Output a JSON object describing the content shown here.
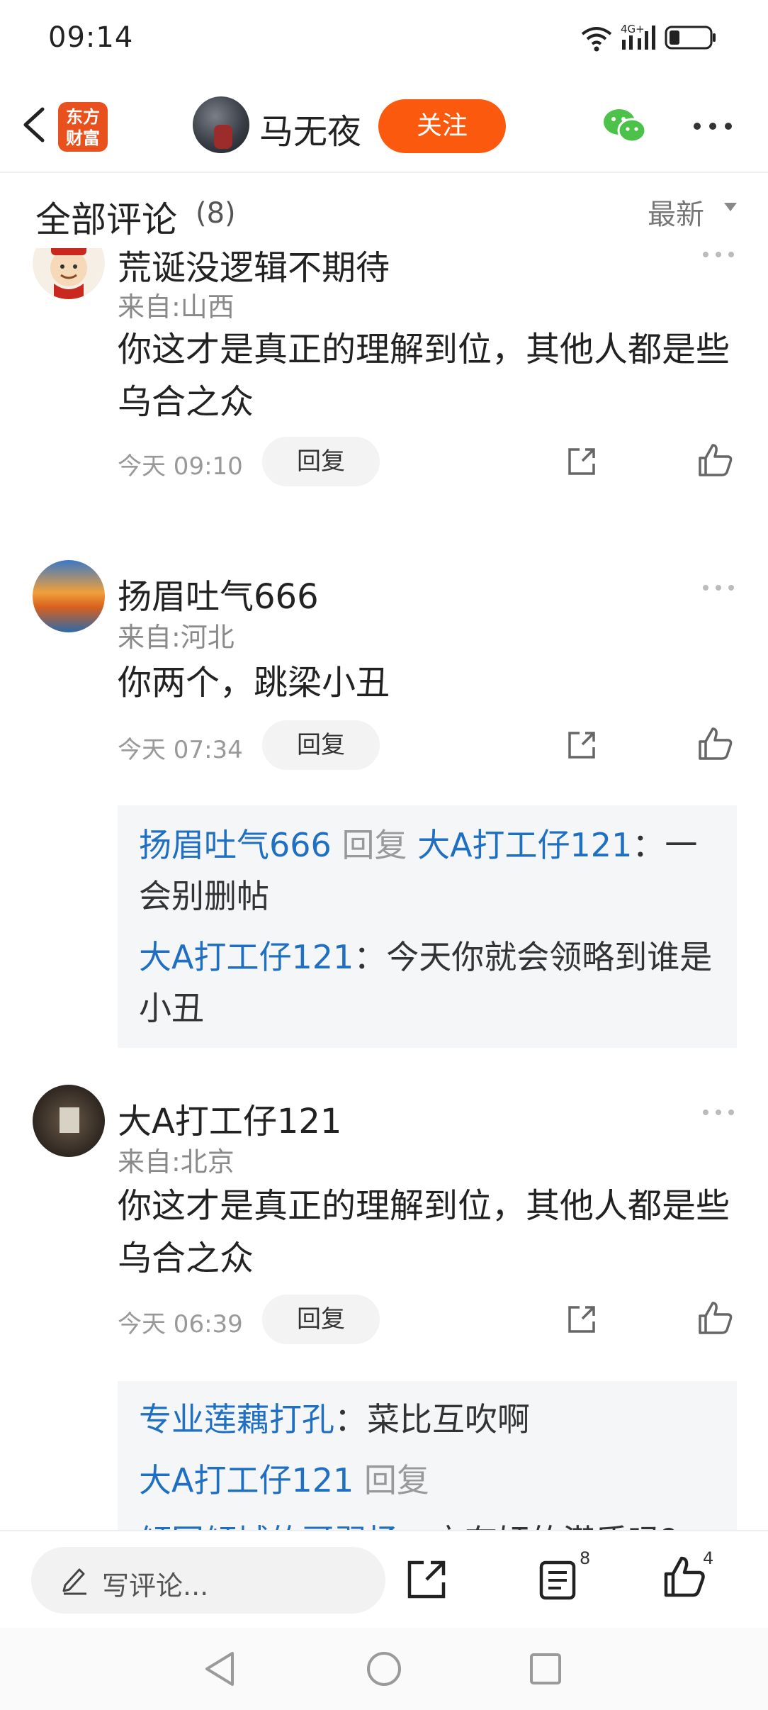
{
  "status_bar": {
    "time": "09:14",
    "network": "4G+"
  },
  "header": {
    "app_logo_line1": "东方",
    "app_logo_line2": "财富",
    "author_name": "马无夜",
    "follow_label": "关注"
  },
  "section": {
    "title": "全部评论",
    "count": "(8)",
    "sort_label": "最新"
  },
  "comments": [
    {
      "username": "荒诞没逻辑不期待",
      "location": "来自:山西",
      "text": "你这才是真正的理解到位，其他人都是些乌合之众",
      "time": "今天 09:10",
      "reply_label": "回复"
    },
    {
      "username": "扬眉吐气666",
      "location": "来自:河北",
      "text": "你两个，跳梁小丑",
      "time": "今天 07:34",
      "reply_label": "回复",
      "replies": [
        {
          "from": "扬眉吐气666",
          "verb": "回复",
          "to": "大A打工仔121",
          "text": "：一会别删帖"
        },
        {
          "from": "大A打工仔121",
          "text": "：今天你就会领略到谁是小丑"
        }
      ]
    },
    {
      "username": "大A打工仔121",
      "location": "来自:北京",
      "text": "你这才是真正的理解到位，其他人都是些乌合之众",
      "time": "今天 06:39",
      "reply_label": "回复",
      "replies": [
        {
          "from": "专业莲藕打孔",
          "text": "：菜比互吹啊"
        },
        {
          "from": "大A打工仔121",
          "verb": "回复"
        },
        {
          "from": "倾国倾城的哥習扬",
          "text": "：宁有奸的潜质吗？"
        }
      ]
    }
  ],
  "bottom_bar": {
    "placeholder": "写评论...",
    "comment_count": "8",
    "like_count": "4"
  },
  "icons": [
    "back-icon",
    "wechat-icon",
    "more-icon",
    "share-icon",
    "like-icon",
    "pen-icon",
    "comment-list-icon"
  ],
  "colors": {
    "brand": "#e8501e",
    "follow": "#fb5a0e",
    "link": "#1f6fc2"
  }
}
